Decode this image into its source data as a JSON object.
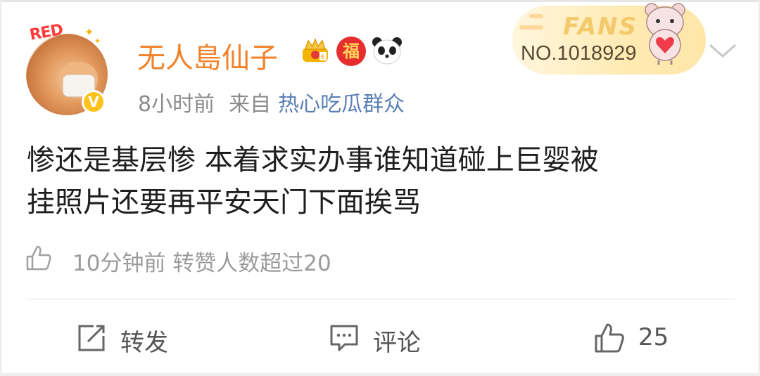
{
  "user": {
    "name": "无人島仙子",
    "avatar_badge": "RED",
    "verified_mark": "V",
    "fu_badge": "福"
  },
  "post": {
    "time": "8小时前",
    "from_label": "来自",
    "source": "热心吃瓜群众",
    "content_lines": [
      "惨还是基层惨 本着求实办事谁知道碰上巨婴被",
      "挂照片还要再平安天门下面挨骂"
    ]
  },
  "fans_card": {
    "label": "FANS",
    "number": "NO.1018929"
  },
  "likes_info": "10分钟前 转赞人数超过20",
  "actions": {
    "repost": "转发",
    "comment": "评论",
    "like_count": "25"
  },
  "colors": {
    "username": "#f0822b",
    "source_link": "#5a7fb4",
    "meta_text": "#8c8c8c"
  },
  "icons": [
    "crown-badge-icon",
    "fu-badge-icon",
    "panda-icon",
    "chevron-down-icon",
    "thumb-up-icon",
    "repost-icon",
    "comment-icon"
  ]
}
